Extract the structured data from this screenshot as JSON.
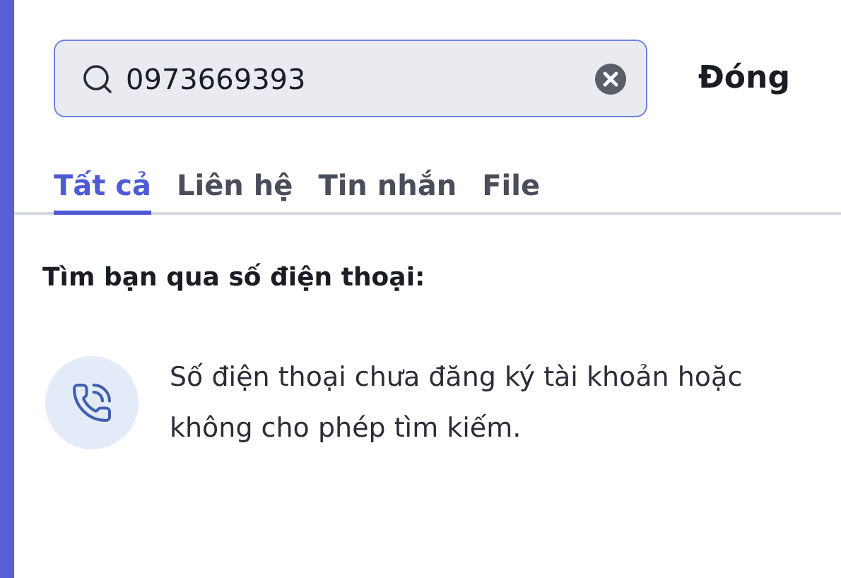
{
  "search": {
    "value": "0973669393"
  },
  "close_label": "Đóng",
  "tabs": [
    {
      "label": "Tất cả",
      "selected": true
    },
    {
      "label": "Liên hệ",
      "selected": false
    },
    {
      "label": "Tin nhắn",
      "selected": false
    },
    {
      "label": "File",
      "selected": false
    }
  ],
  "section_title": "Tìm bạn qua số điện thoại:",
  "message": "Số điện thoại chưa đăng ký tài khoản hoặc không cho phép tìm kiếm."
}
